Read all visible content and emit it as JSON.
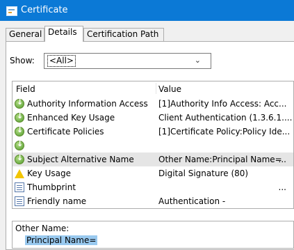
{
  "window": {
    "title": "Certificate"
  },
  "tabs": [
    "General",
    "Details",
    "Certification Path"
  ],
  "show": {
    "label": "Show:",
    "value": "<All>"
  },
  "list": {
    "headers": {
      "field": "Field",
      "value": "Value"
    },
    "rows": [
      {
        "icon": "cert-extension-icon",
        "field": "Authority Information Access",
        "value": "[1]Authority Info Access: Acc..."
      },
      {
        "icon": "cert-extension-icon",
        "field": "Enhanced Key Usage",
        "value": "Client Authentication (1.3.6.1...."
      },
      {
        "icon": "cert-extension-icon",
        "field": "Certificate Policies",
        "value": "[1]Certificate Policy:Policy Ide..."
      },
      {
        "icon": "cert-extension-icon",
        "field": "",
        "value": ""
      },
      {
        "icon": "cert-extension-icon",
        "field": "Subject Alternative Name",
        "value": "Other Name:Principal Name=",
        "more": "...",
        "selected": true
      },
      {
        "icon": "warning-icon",
        "field": "Key Usage",
        "value": "Digital Signature (80)"
      },
      {
        "icon": "document-icon",
        "field": "Thumbprint",
        "value": "",
        "more": "..."
      },
      {
        "icon": "document-icon",
        "field": "Friendly name",
        "value": "Authentication -"
      }
    ]
  },
  "details": {
    "line1": "Other Name:",
    "line2": "Principal Name="
  }
}
